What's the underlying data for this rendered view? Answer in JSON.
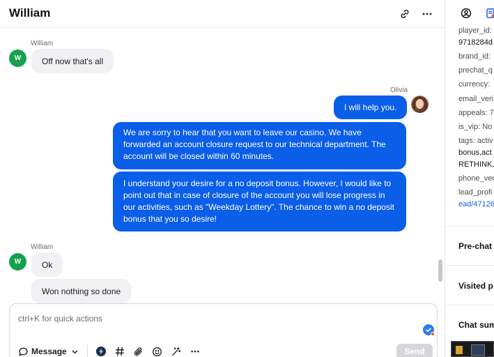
{
  "chat": {
    "title": "William",
    "messages": [
      {
        "author": "William",
        "avatar_letter": "W",
        "bubbles": [
          "Off now that's all"
        ]
      },
      {
        "author": "Olivia",
        "bubbles": [
          "I will help you.",
          "We are sorry to hear that you want to leave our casino. We have forwarded an account closure request to our technical department. The account will be closed within 60 minutes.",
          "I understand your desire for a no deposit bonus. However, I would like to point out that in case of closure of the account you will lose progress in our activities, such as \"Weekday Lottery\". The chance to win a no deposit bonus that you so desire!"
        ]
      },
      {
        "author": "William",
        "avatar_letter": "W",
        "bubbles": [
          "Ok",
          "Won nothing so done"
        ]
      }
    ],
    "composer": {
      "placeholder": "ctrl+K for quick actions",
      "mode_label": "Message",
      "send_label": "Send"
    },
    "header_icons": [
      "link-icon",
      "more-icon"
    ],
    "toolbar_icons": [
      "chat-bubble-icon",
      "chevron-down-icon",
      "ai-icon",
      "hash-icon",
      "paperclip-icon",
      "emoji-icon",
      "magic-wand-icon",
      "more-icon"
    ]
  },
  "side_panel": {
    "tab_icons": [
      "user-circle-icon",
      "document-icon"
    ],
    "fields": [
      {
        "text": "player_id:",
        "kind": "label"
      },
      {
        "text": "9718284d",
        "kind": "value"
      },
      {
        "text": "brand_id:",
        "kind": "label"
      },
      {
        "text": "prechat_q",
        "kind": "label"
      },
      {
        "text": "currency:",
        "kind": "label"
      },
      {
        "text": "email_veri",
        "kind": "label"
      },
      {
        "text": "appeals: 7",
        "kind": "label"
      },
      {
        "text": "is_vip: No",
        "kind": "label"
      },
      {
        "text": "tags: activ",
        "kind": "label"
      },
      {
        "text": "bonus,act",
        "kind": "value"
      },
      {
        "text": "RETHINK,",
        "kind": "value"
      },
      {
        "text": "phone_ver",
        "kind": "label"
      },
      {
        "text": "lead_profi",
        "kind": "label"
      },
      {
        "text": "ead/47126",
        "kind": "link"
      }
    ],
    "sections": [
      "Pre-chat",
      "Visited p",
      "Chat sum"
    ]
  },
  "colors": {
    "accent": "#0a5ee8",
    "agent_avatar_bg": "#15a150",
    "incoming_bubble": "#f1f1f3"
  }
}
